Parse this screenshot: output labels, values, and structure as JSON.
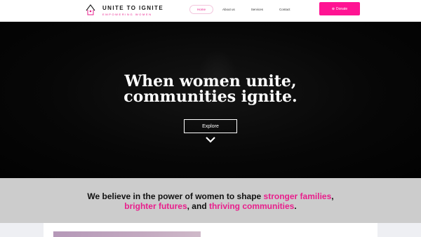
{
  "brand": {
    "name": "UNITE TO IGNITE",
    "tagline": "EMPOWERING WOMEN",
    "accent_color": "#e91e8c",
    "logo_icon": "house-outline-icon"
  },
  "nav": {
    "items": [
      {
        "label": "Home",
        "active": true
      },
      {
        "label": "About us",
        "active": false
      },
      {
        "label": "Services",
        "active": false
      },
      {
        "label": "Contact",
        "active": false
      }
    ]
  },
  "donate": {
    "label": "Donate",
    "icon": "plus-circle-icon",
    "color": "#ff1493"
  },
  "hero": {
    "heading_line1": "When women unite,",
    "heading_line2": "communities ignite.",
    "cta_label": "Explore",
    "scroll_icon": "chevron-down-icon"
  },
  "belief": {
    "part1": "We believe in the power of women to shape ",
    "hl1": "stronger families",
    "part2": ", ",
    "hl2": "brighter futures",
    "part3": ", and ",
    "hl3": "thriving communities",
    "part4": "."
  }
}
